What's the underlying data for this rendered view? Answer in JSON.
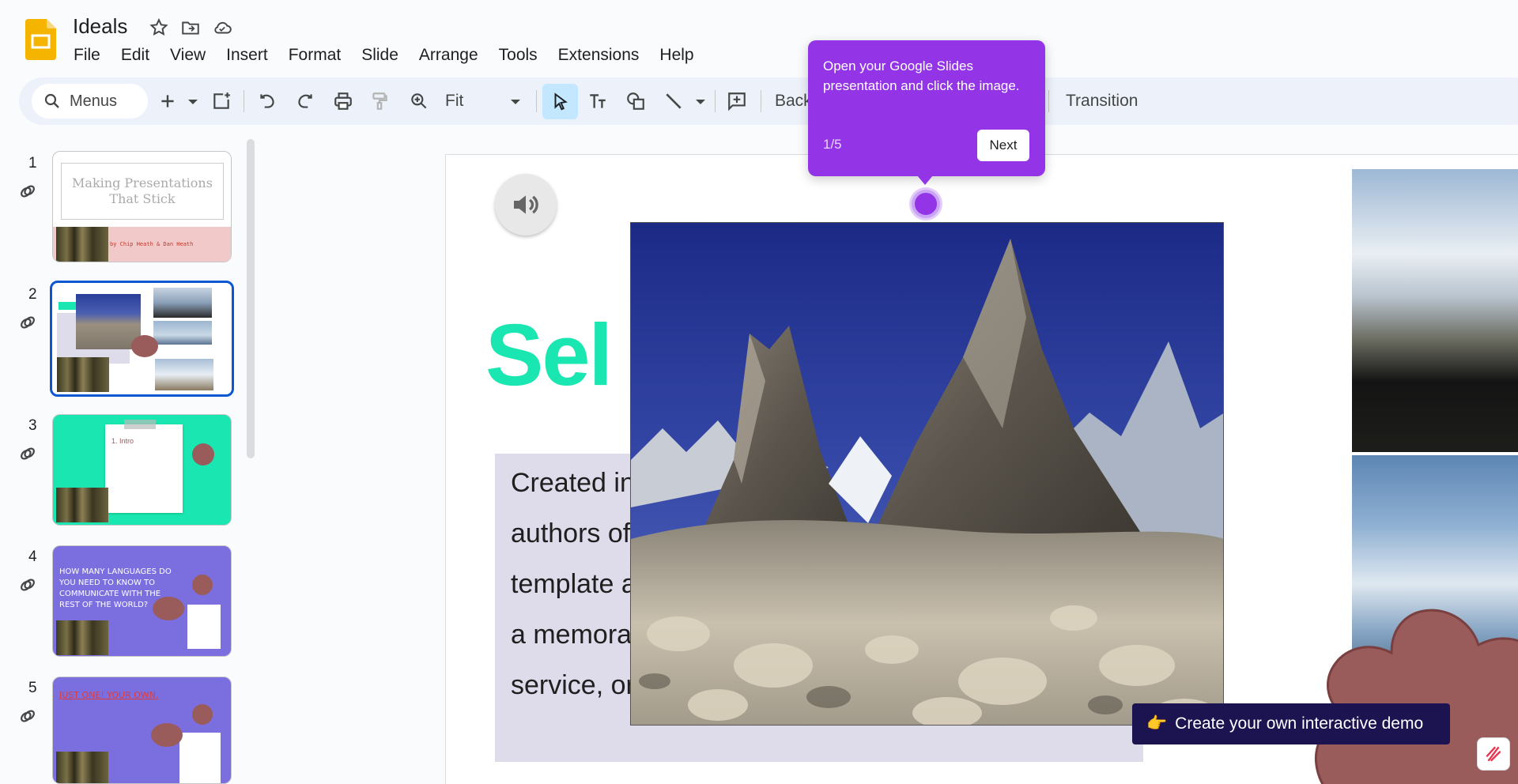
{
  "app": {
    "title": "Ideals",
    "brand_color": "#f4b400"
  },
  "menu": [
    "File",
    "Edit",
    "View",
    "Insert",
    "Format",
    "Slide",
    "Arrange",
    "Tools",
    "Extensions",
    "Help"
  ],
  "toolbar": {
    "search_label": "Menus",
    "zoom_value": "Fit",
    "background_label": "Back",
    "transition_label": "Transition",
    "selected_tool_color": "#c2e7ff"
  },
  "slides": [
    {
      "number": "1",
      "title": "Making Presentations That Stick",
      "subtitle": "by Chip Heath & Dan Heath"
    },
    {
      "number": "2"
    },
    {
      "number": "3",
      "heading": "1. Intro"
    },
    {
      "number": "4",
      "title": "How many languages do you need to know to communicate with the rest of the world?"
    },
    {
      "number": "5",
      "title": "Just one! Your own."
    }
  ],
  "slide_canvas": {
    "title_visible": "Sel",
    "body_lines": [
      "Created in",
      "authors of",
      "template a",
      "a memora",
      "service, or"
    ],
    "title_color": "#19e6b0"
  },
  "tour": {
    "text": "Open your Google Slides presentation and click the image.",
    "step": "1/5",
    "next_label": "Next",
    "color": "#9334e6"
  },
  "cta": {
    "emoji": "👉",
    "label": "Create your own interactive demo"
  }
}
